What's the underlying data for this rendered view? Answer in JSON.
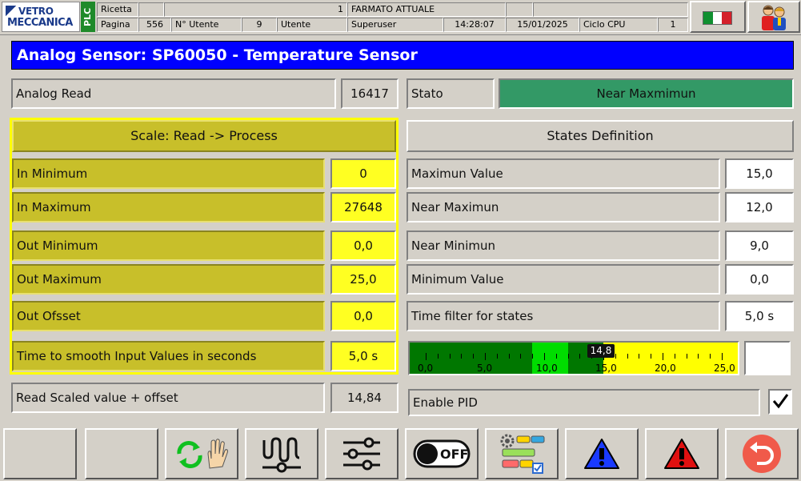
{
  "header": {
    "logo_line1": "VETRO",
    "logo_line2": "MECCANICA",
    "plc_label": "PLC",
    "row1": {
      "label": "Ricetta",
      "recipe_number": "1",
      "recipe_name": "FARMATO ATTUALE"
    },
    "row2": {
      "page_label": "Pagina",
      "page_number": "556",
      "user_num_label": "N° Utente",
      "user_number": "9",
      "user_label": "Utente",
      "user_name": "Superuser",
      "time": "14:28:07",
      "date": "15/01/2025",
      "cpu_label": "Ciclo CPU",
      "cpu_value": "1"
    },
    "language_flag": "italy-flag-icon",
    "users_icon": "users-icon"
  },
  "title": "Analog Sensor: SP60050 - Temperature Sensor",
  "analog_read": {
    "label": "Analog Read",
    "value": "16417"
  },
  "stato": {
    "label": "Stato",
    "value": "Near Maxmimun",
    "color": "#339966"
  },
  "scale": {
    "header": "Scale: Read -> Process",
    "rows": [
      {
        "label": "In Minimum",
        "value": "0"
      },
      {
        "label": "In Maximum",
        "value": "27648"
      },
      {
        "label": "Out Minimum",
        "value": "0,0"
      },
      {
        "label": "Out Maximum",
        "value": "25,0"
      },
      {
        "label": "Out Ofsset",
        "value": "0,0"
      },
      {
        "label": "Time to smooth Input Values in seconds",
        "value": "5,0 s"
      }
    ]
  },
  "states": {
    "header": "States Definition",
    "rows": [
      {
        "label": "Maximun Value",
        "value": "15,0"
      },
      {
        "label": "Near Maximun",
        "value": "12,0"
      },
      {
        "label": "Near Minimun",
        "value": "9,0"
      },
      {
        "label": "Minimum Value",
        "value": "0,0"
      },
      {
        "label": "Time filter for states",
        "value": "5,0 s"
      }
    ]
  },
  "read_scaled": {
    "label": "Read Scaled value + offset",
    "value": "14,84"
  },
  "gauge": {
    "min": 0,
    "max": 25,
    "current": 14.84,
    "current_label": "14,8",
    "tick_labels": [
      "0,0",
      "5,0",
      "10,0",
      "15,0",
      "20,0",
      "25,0"
    ],
    "zones": [
      {
        "from": 0,
        "to": 9,
        "color": "#007700"
      },
      {
        "from": 9,
        "to": 12,
        "color": "#00dd00"
      },
      {
        "from": 12,
        "to": 15,
        "color": "#007700"
      },
      {
        "from": 15,
        "to": 25,
        "color": "#ffff00"
      }
    ]
  },
  "enable_pid": {
    "label": "Enable PID",
    "checked": true
  },
  "toolbar": [
    {
      "name": "toolbar-empty-1",
      "icon": ""
    },
    {
      "name": "toolbar-empty-2",
      "icon": ""
    },
    {
      "name": "auto-manual-button",
      "icon": "cycle-hand-icon"
    },
    {
      "name": "sensor-signal-button",
      "icon": "wave-signal-icon"
    },
    {
      "name": "settings-sliders-button",
      "icon": "sliders-icon"
    },
    {
      "name": "off-button",
      "icon": "off-toggle-icon"
    },
    {
      "name": "process-config-button",
      "icon": "process-gear-icon"
    },
    {
      "name": "warning-blue-button",
      "icon": "warning-blue-icon"
    },
    {
      "name": "alarm-red-button",
      "icon": "alarm-red-icon"
    },
    {
      "name": "back-button",
      "icon": "return-icon"
    }
  ]
}
